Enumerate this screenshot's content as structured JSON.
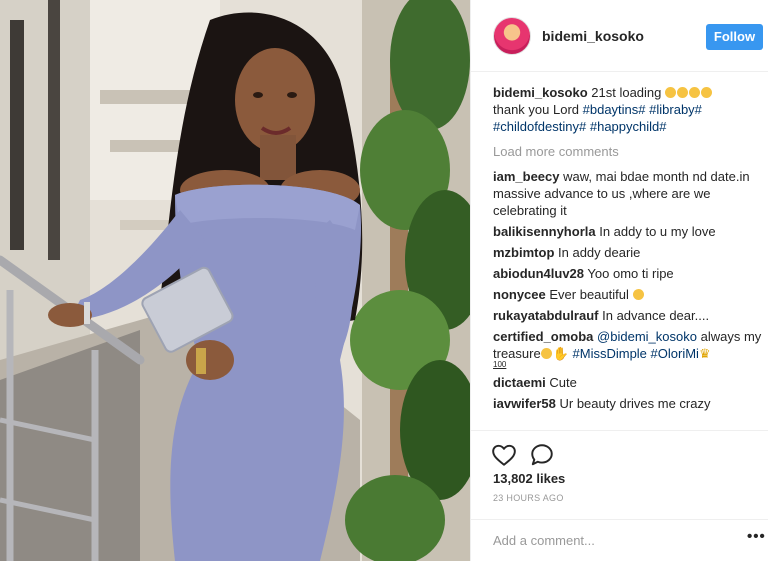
{
  "post": {
    "username": "bidemi_kosoko",
    "follow_label": "Follow"
  },
  "caption": {
    "user": "bidemi_kosoko",
    "text": "21st loading",
    "text2": "thank you Lord",
    "hashtags": [
      "#bdaytins#",
      "#libraby#",
      "#childofdestiny#",
      "#happychild#"
    ]
  },
  "load_more": "Load more comments",
  "comments": [
    {
      "user": "iam_beecy",
      "text": "waw, mai bdae month nd date.in massive advance to us ,where are we celebrating it"
    },
    {
      "user": "balikisennyhorla",
      "text": "In addy to u my love"
    },
    {
      "user": "mzbimtop",
      "text": "In addy dearie"
    },
    {
      "user": "abiodun4luv28",
      "text": "Yoo omo ti ripe"
    },
    {
      "user": "nonycee",
      "text": "Ever beautiful"
    },
    {
      "user": "rukayatabdulrauf",
      "text": "In advance dear...."
    },
    {
      "user": "certified_omoba",
      "mention": "@bidemi_kosoko",
      "text": "always my treasure",
      "hashtags": [
        "#MissDimple",
        "#OloriMi"
      ],
      "badge": "100"
    },
    {
      "user": "dictaemi",
      "text": "Cute"
    },
    {
      "user": "iavwifer58",
      "text": "Ur beauty drives me crazy"
    }
  ],
  "stats": {
    "likes": "13,802 likes",
    "time": "23 HOURS AGO"
  },
  "add_comment": {
    "placeholder": "Add a comment..."
  },
  "icons": {
    "like": "heart-icon",
    "comment": "comment-bubble-icon",
    "more": "more-options-icon"
  },
  "colors": {
    "follow_bg": "#3897f0",
    "hashtag": "#003569",
    "muted": "#999999"
  }
}
